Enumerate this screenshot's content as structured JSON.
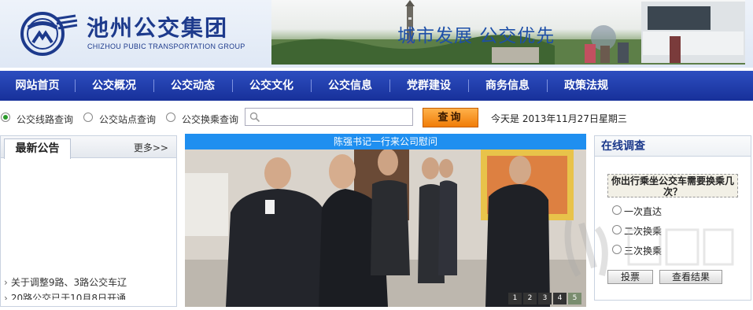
{
  "header": {
    "brand_cn": "池州公交集团",
    "brand_en": "CHIZHOU PUBIC TRANSPORTATION GROUP",
    "slogan": "城市发展  公交优先"
  },
  "nav": {
    "items": [
      "网站首页",
      "公交概况",
      "公交动态",
      "公交文化",
      "公交信息",
      "党群建设",
      "商务信息",
      "政策法规"
    ]
  },
  "search": {
    "options": [
      "公交线路查询",
      "公交站点查询",
      "公交换乘查询"
    ],
    "selected": 0,
    "input_value": "",
    "button_label": "查询",
    "today": "今天是  2013年11月27日星期三"
  },
  "notice": {
    "tab": "最新公告",
    "more": "更多>>",
    "items": [
      "关于调整9路、3路公交车辽",
      "20路公交已于10月8日开通"
    ]
  },
  "photo": {
    "caption": "陈强书记一行来公司慰问",
    "pages": [
      "1",
      "2",
      "3",
      "4",
      "5"
    ],
    "active_page": 4
  },
  "poll": {
    "title": "在线调查",
    "question": "你出行乘坐公交车需要换乘几次？",
    "options": [
      "一次直达",
      "二次换乘",
      "三次换乘"
    ],
    "vote_label": "投票",
    "result_label": "查看结果"
  },
  "colors": {
    "nav_bg": "#1d38a8",
    "caption_bg": "#1f8ff0",
    "search_btn": "#f08a10",
    "brand": "#1d3a8c"
  }
}
